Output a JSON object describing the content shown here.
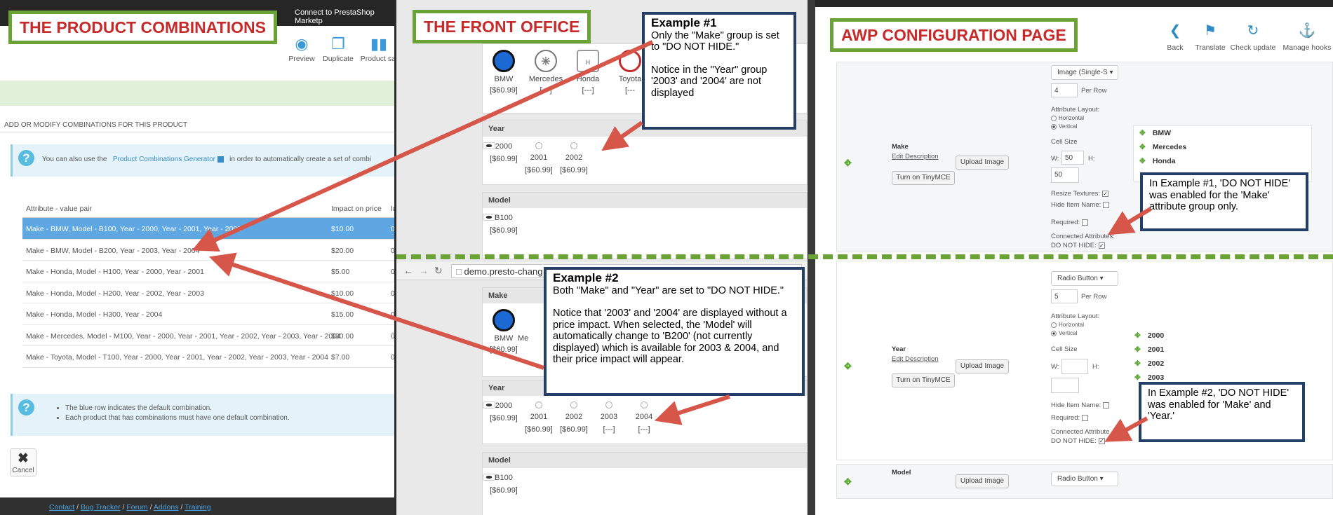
{
  "labels": {
    "product_combinations": "THE PRODUCT COMBINATIONS",
    "front_office": "THE FRONT OFFICE",
    "awp_config": "AWP CONFIGURATION PAGE"
  },
  "panel1": {
    "topbar_text": "Connect to PrestaShop Marketp",
    "toolbar": [
      {
        "label": "Preview",
        "icon": "eye-icon"
      },
      {
        "label": "Duplicate",
        "icon": "duplicate-icon"
      },
      {
        "label": "Product sal",
        "icon": "chart-icon"
      }
    ],
    "section_title": "ADD OR MODIFY COMBINATIONS FOR THIS PRODUCT",
    "info_prefix": "You can also use the",
    "info_link": "Product Combinations Generator",
    "info_suffix": "in order to automatically create a set of combi",
    "columns": [
      "Attribute - value pair",
      "Impact on price",
      "Im"
    ],
    "rows": [
      {
        "pair": "Make - BMW, Model - B100, Year - 2000, Year - 2001, Year - 2002",
        "price": "$10.00",
        "extra": "0"
      },
      {
        "pair": "Make - BMW, Model - B200, Year - 2003, Year - 2004",
        "price": "$20.00",
        "extra": "0"
      },
      {
        "pair": "Make - Honda, Model - H100, Year - 2000, Year - 2001",
        "price": "$5.00",
        "extra": "0"
      },
      {
        "pair": "Make - Honda, Model - H200, Year - 2002, Year - 2003",
        "price": "$10.00",
        "extra": "0"
      },
      {
        "pair": "Make - Honda, Model - H300, Year - 2004",
        "price": "$15.00",
        "extra": "0"
      },
      {
        "pair": "Make - Mercedes, Model - M100, Year - 2000, Year - 2001, Year - 2002, Year - 2003, Year - 2004",
        "price": "$30.00",
        "extra": "0"
      },
      {
        "pair": "Make - Toyota, Model - T100, Year - 2000, Year - 2001, Year - 2002, Year - 2003, Year - 2004",
        "price": "$7.00",
        "extra": "0"
      }
    ],
    "notes": [
      "The blue row indicates the default combination.",
      "Each product that has combinations must have one default combination."
    ],
    "cancel": "Cancel",
    "footer": [
      "Contact",
      "Bug Tracker",
      "Forum",
      "Addons",
      "Training"
    ]
  },
  "panel2": {
    "makes": [
      {
        "name": "BMW",
        "price": "[$60.99]"
      },
      {
        "name": "Mercedes",
        "price": "[---]"
      },
      {
        "name": "Honda",
        "price": "[---]"
      },
      {
        "name": "Toyota",
        "price": "[---"
      }
    ],
    "year_title": "Year",
    "years1": [
      {
        "label": "2000",
        "price": "[$60.99]"
      },
      {
        "label": "2001",
        "price": "[$60.99]"
      },
      {
        "label": "2002",
        "price": "[$60.99]"
      }
    ],
    "model_title": "Model",
    "model1": {
      "label": "B100",
      "price": "[$60.99]"
    },
    "url": "demo.presto-chang",
    "make_title": "Make",
    "make2": {
      "name": "BMW",
      "price": "[$60.99]",
      "next": "Me"
    },
    "years2": [
      {
        "label": "2000",
        "price": "[$60.99]"
      },
      {
        "label": "2001",
        "price": "[$60.99]"
      },
      {
        "label": "2002",
        "price": "[$60.99]"
      },
      {
        "label": "2003",
        "price": "[---]"
      },
      {
        "label": "2004",
        "price": "[---]"
      }
    ],
    "model2": {
      "label": "B100",
      "price": "[$60.99]"
    }
  },
  "panel3": {
    "toolbar": [
      {
        "label": "Back",
        "icon": "back-icon"
      },
      {
        "label": "Translate",
        "icon": "flag-icon"
      },
      {
        "label": "Check update",
        "icon": "refresh-icon"
      },
      {
        "label": "Manage hooks",
        "icon": "anchor-icon"
      }
    ],
    "make": {
      "name": "Make",
      "edit": "Edit Description",
      "tiny": "Turn on TinyMCE",
      "upload": "Upload Image",
      "display": "Image (Single-S",
      "per_row_value": "4",
      "per_row": "Per Row",
      "layout": "Attribute Layout:",
      "horizontal": "Horizontal",
      "vertical": "Vertical",
      "cell_size": "Cell Size",
      "w_label": "W:",
      "w": "50",
      "h_label": "H:",
      "h": "50",
      "resize": "Resize Textures:",
      "hide_name": "Hide Item Name:",
      "required": "Required:",
      "connected": "Connected Attributes:",
      "dnh": "DO NOT HIDE:",
      "items": [
        "BMW",
        "Mercedes",
        "Honda"
      ]
    },
    "year": {
      "name": "Year",
      "edit": "Edit Description",
      "tiny": "Turn on TinyMCE",
      "upload": "Upload Image",
      "display": "Radio Button",
      "per_row_value": "5",
      "per_row": "Per Row",
      "layout": "Attribute Layout:",
      "horizontal": "Horizontal",
      "vertical": "Vertical",
      "cell_size": "Cell Size",
      "w_label": "W:",
      "h_label": "H:",
      "hide_name": "Hide Item Name:",
      "required": "Required:",
      "connected": "Connected Attribute",
      "dnh": "DO NOT HIDE:",
      "items": [
        "2000",
        "2001",
        "2002",
        "2003"
      ]
    },
    "model": {
      "name": "Model",
      "upload": "Upload Image",
      "display": "Radio Button"
    }
  },
  "callouts": {
    "ex1_title": "Example #1",
    "ex1_p1": "Only the \"Make\" group is set to \"DO NOT HIDE.\"",
    "ex1_p2": "Notice in the \"Year\" group '2003' and '2004' are not displayed",
    "ex2_title": "Example #2",
    "ex2_p1": "Both \"Make\" and \"Year\" are set to \"DO NOT HIDE.\"",
    "ex2_p2": "Notice that '2003' and '2004' are displayed without a price impact. When selected, the 'Model' will automatically change to 'B200' (not currently displayed) which is available for 2003 & 2004, and their price impact will appear.",
    "note1": "In Example #1, 'DO NOT HIDE' was enabled for the 'Make' attribute group  only.",
    "note2": "In Example #2, 'DO NOT HIDE' was enabled for 'Make' and 'Year.'"
  },
  "colors": {
    "label_border": "#6aa236",
    "label_text": "#c62a2a",
    "callout_border": "#243f66",
    "arrow": "#d6574a",
    "default_row": "#5fa7e3"
  }
}
